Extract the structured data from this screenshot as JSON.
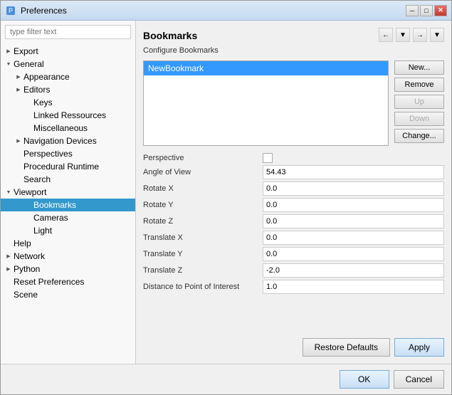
{
  "window": {
    "title": "Preferences",
    "icon": "⚙"
  },
  "titlebar": {
    "minimize": "─",
    "maximize": "□",
    "close": "✕"
  },
  "filter": {
    "placeholder": "type filter text",
    "value": ""
  },
  "tree": {
    "items": [
      {
        "id": "export",
        "label": "Export",
        "indent": 1,
        "expandable": true,
        "expanded": false
      },
      {
        "id": "general",
        "label": "General",
        "indent": 1,
        "expandable": true,
        "expanded": true
      },
      {
        "id": "appearance",
        "label": "Appearance",
        "indent": 2,
        "expandable": true,
        "expanded": false
      },
      {
        "id": "editors",
        "label": "Editors",
        "indent": 2,
        "expandable": true,
        "expanded": false
      },
      {
        "id": "keys",
        "label": "Keys",
        "indent": 3,
        "expandable": false
      },
      {
        "id": "linked-resources",
        "label": "Linked Ressources",
        "indent": 3,
        "expandable": false
      },
      {
        "id": "miscellaneous",
        "label": "Miscellaneous",
        "indent": 3,
        "expandable": false
      },
      {
        "id": "navigation-devices",
        "label": "Navigation Devices",
        "indent": 2,
        "expandable": true,
        "expanded": false
      },
      {
        "id": "perspectives",
        "label": "Perspectives",
        "indent": 2,
        "expandable": false
      },
      {
        "id": "procedural-runtime",
        "label": "Procedural Runtime",
        "indent": 2,
        "expandable": false
      },
      {
        "id": "search",
        "label": "Search",
        "indent": 2,
        "expandable": false
      },
      {
        "id": "viewport",
        "label": "Viewport",
        "indent": 1,
        "expandable": true,
        "expanded": true
      },
      {
        "id": "bookmarks",
        "label": "Bookmarks",
        "indent": 3,
        "expandable": false,
        "selected": true
      },
      {
        "id": "cameras",
        "label": "Cameras",
        "indent": 3,
        "expandable": false
      },
      {
        "id": "light",
        "label": "Light",
        "indent": 3,
        "expandable": false
      },
      {
        "id": "help",
        "label": "Help",
        "indent": 1,
        "expandable": false
      },
      {
        "id": "network",
        "label": "Network",
        "indent": 1,
        "expandable": true,
        "expanded": false
      },
      {
        "id": "python",
        "label": "Python",
        "indent": 1,
        "expandable": true,
        "expanded": false
      },
      {
        "id": "reset-preferences",
        "label": "Reset Preferences",
        "indent": 1,
        "expandable": false
      },
      {
        "id": "scene",
        "label": "Scene",
        "indent": 1,
        "expandable": false
      }
    ]
  },
  "main": {
    "section_title": "Bookmarks",
    "configure_label": "Configure Bookmarks",
    "toolbar_buttons": [
      "←",
      "→",
      "↓",
      "▾"
    ],
    "bookmarks": [
      {
        "id": "new-bookmark",
        "label": "NewBookmark",
        "selected": true
      }
    ],
    "bookmark_buttons": {
      "new": "New...",
      "remove": "Remove",
      "up": "Up",
      "down": "Down",
      "change": "Change..."
    },
    "properties": [
      {
        "id": "perspective",
        "label": "Perspective",
        "type": "checkbox",
        "value": ""
      },
      {
        "id": "angle-of-view",
        "label": "Angle of View",
        "type": "text",
        "value": "54.43"
      },
      {
        "id": "rotate-x",
        "label": "Rotate X",
        "type": "text",
        "value": "0.0"
      },
      {
        "id": "rotate-y",
        "label": "Rotate Y",
        "type": "text",
        "value": "0.0"
      },
      {
        "id": "rotate-z",
        "label": "Rotate Z",
        "type": "text",
        "value": "0.0"
      },
      {
        "id": "translate-x",
        "label": "Translate X",
        "type": "text",
        "value": "0.0"
      },
      {
        "id": "translate-y",
        "label": "Translate Y",
        "type": "text",
        "value": "0.0"
      },
      {
        "id": "translate-z",
        "label": "Translate Z",
        "type": "text",
        "value": "-2.0"
      },
      {
        "id": "distance-to-poi",
        "label": "Distance to Point of Interest",
        "type": "text",
        "value": "1.0"
      }
    ]
  },
  "footer": {
    "restore_defaults": "Restore Defaults",
    "apply": "Apply",
    "ok": "OK",
    "cancel": "Cancel"
  }
}
